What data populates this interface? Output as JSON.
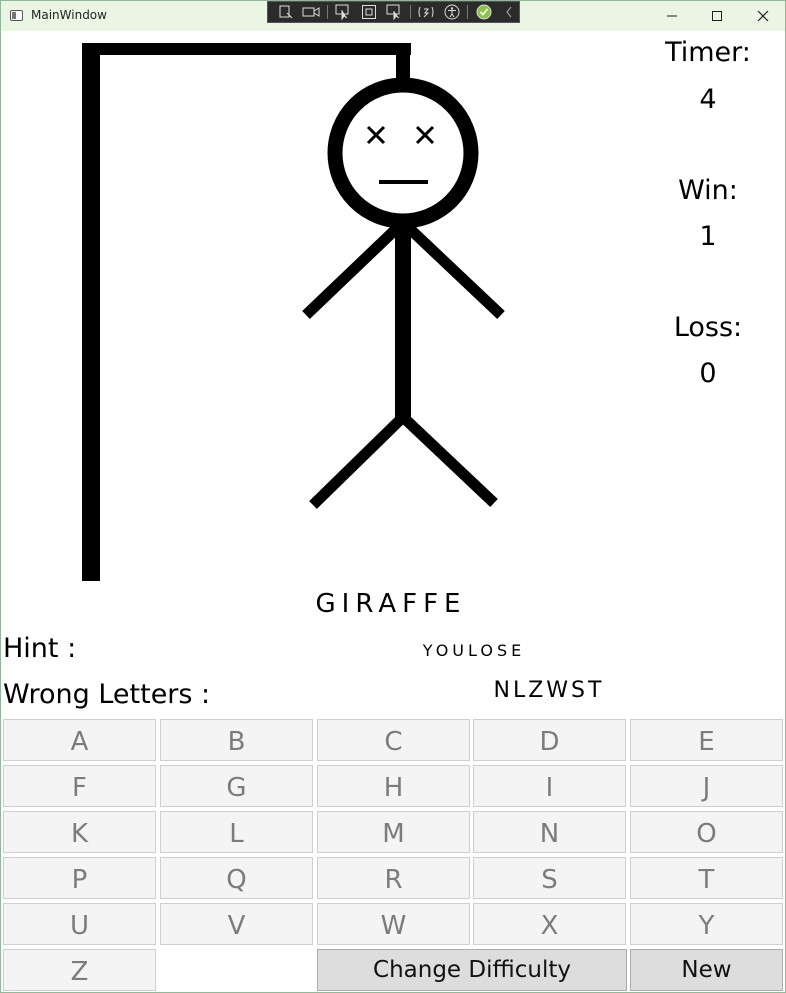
{
  "window": {
    "title": "MainWindow"
  },
  "hud": {
    "timer_label": "Timer:",
    "timer_value": "4",
    "win_label": "Win:",
    "win_value": "1",
    "loss_label": "Loss:",
    "loss_value": "0"
  },
  "game": {
    "word": "GIRAFFE",
    "hint_label": "Hint :",
    "hint_value": "YOULOSE",
    "wrong_label": "Wrong Letters :",
    "wrong_letters": "NLZWST"
  },
  "keyboard": {
    "letters": [
      "A",
      "B",
      "C",
      "D",
      "E",
      "F",
      "G",
      "H",
      "I",
      "J",
      "K",
      "L",
      "M",
      "N",
      "O",
      "P",
      "Q",
      "R",
      "S",
      "T",
      "U",
      "V",
      "W",
      "X",
      "Y",
      "Z"
    ]
  },
  "actions": {
    "change_difficulty": "Change Difficulty",
    "new_game": "New"
  },
  "icons": {
    "app": "app-window-icon",
    "minimize": "minimize-icon",
    "maximize": "maximize-icon",
    "close": "close-icon"
  },
  "colors": {
    "titlebar": "#eaf5e4",
    "key_bg": "#f4f4f4",
    "key_text": "#7c7c7c",
    "action_bg": "#dddddd"
  }
}
